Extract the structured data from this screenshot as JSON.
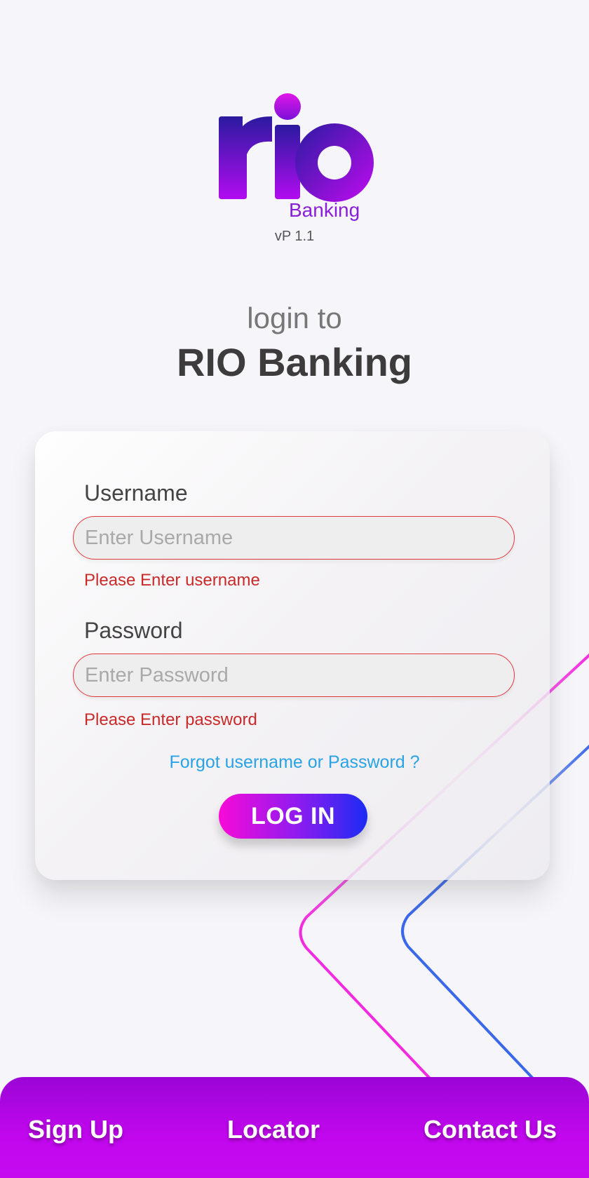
{
  "app": {
    "brand_sub": "Banking",
    "version": "vP 1.1",
    "colors": {
      "brand_purple": "#8a1fd8",
      "brand_navy": "#2a1aa0",
      "accent_pink": "#f80ad8",
      "accent_blue": "#1b2cf4",
      "error_red": "#c92a2a",
      "link_blue": "#29a3e6",
      "bar_purple": "#c207ee"
    }
  },
  "heading": {
    "subtitle": "login to",
    "title": "RIO Banking"
  },
  "form": {
    "username": {
      "label": "Username",
      "value": "",
      "placeholder": "Enter Username",
      "error": "Please Enter username"
    },
    "password": {
      "label": "Password",
      "value": "",
      "placeholder": "Enter Password",
      "error": "Please Enter password"
    },
    "forgot_link": "Forgot username or Password ?",
    "login_button": "LOG IN"
  },
  "bottom_bar": {
    "items": [
      {
        "label": "Sign Up"
      },
      {
        "label": "Locator"
      },
      {
        "label": "Contact Us"
      }
    ]
  }
}
